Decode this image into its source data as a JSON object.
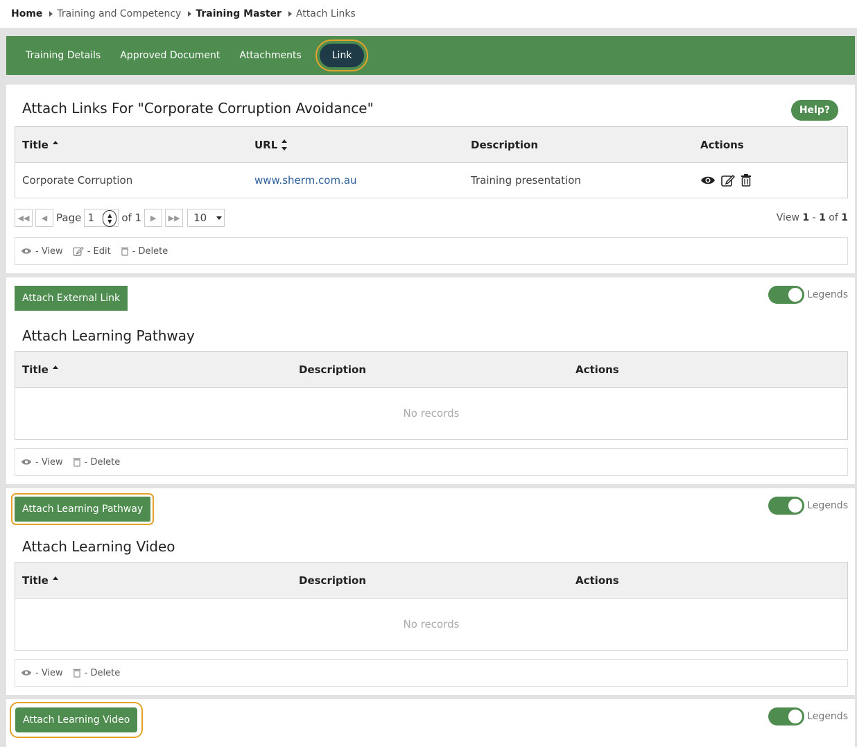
{
  "breadcrumb": {
    "home": "Home",
    "item1": "Training and Competency",
    "item2": "Training Master",
    "item3": "Attach Links"
  },
  "tabs": [
    {
      "label": "Training Details"
    },
    {
      "label": "Approved Document"
    },
    {
      "label": "Attachments"
    },
    {
      "label": "Link"
    }
  ],
  "links_section": {
    "title": "Attach Links For \"Corporate Corruption Avoidance\"",
    "help_label": "Help?",
    "columns": [
      "Title",
      "URL",
      "Description",
      "Actions"
    ],
    "rows": [
      {
        "title": "Corporate Corruption",
        "url": "www.sherm.com.au",
        "description": "Training presentation"
      }
    ],
    "pager": {
      "page_label": "Page",
      "page_value": "1",
      "of_label": "of 1",
      "page_size": "10",
      "view_prefix": "View",
      "view_from": "1",
      "view_dash": "-",
      "view_to": "1",
      "view_of": "of",
      "view_total": "1"
    },
    "legend": {
      "view": "- View",
      "edit": "- Edit",
      "delete": "- Delete"
    },
    "button_label": "Attach External Link",
    "toggle_label": "Legends"
  },
  "pathway_section": {
    "title": "Attach Learning Pathway",
    "columns": [
      "Title",
      "Description",
      "Actions"
    ],
    "empty": "No records",
    "legend": {
      "view": "- View",
      "delete": "- Delete"
    },
    "button_label": "Attach Learning Pathway",
    "toggle_label": "Legends"
  },
  "video_section": {
    "title": "Attach Learning Video",
    "columns": [
      "Title",
      "Description",
      "Actions"
    ],
    "empty": "No records",
    "legend": {
      "view": "- View",
      "delete": "- Delete"
    },
    "button_label": "Attach Learning Video",
    "toggle_label": "Legends"
  },
  "colors": {
    "brand_green": "#4f8c4f",
    "active_tab": "#1e3b47",
    "highlight": "#e3a32b",
    "link": "#2d5f9a"
  }
}
